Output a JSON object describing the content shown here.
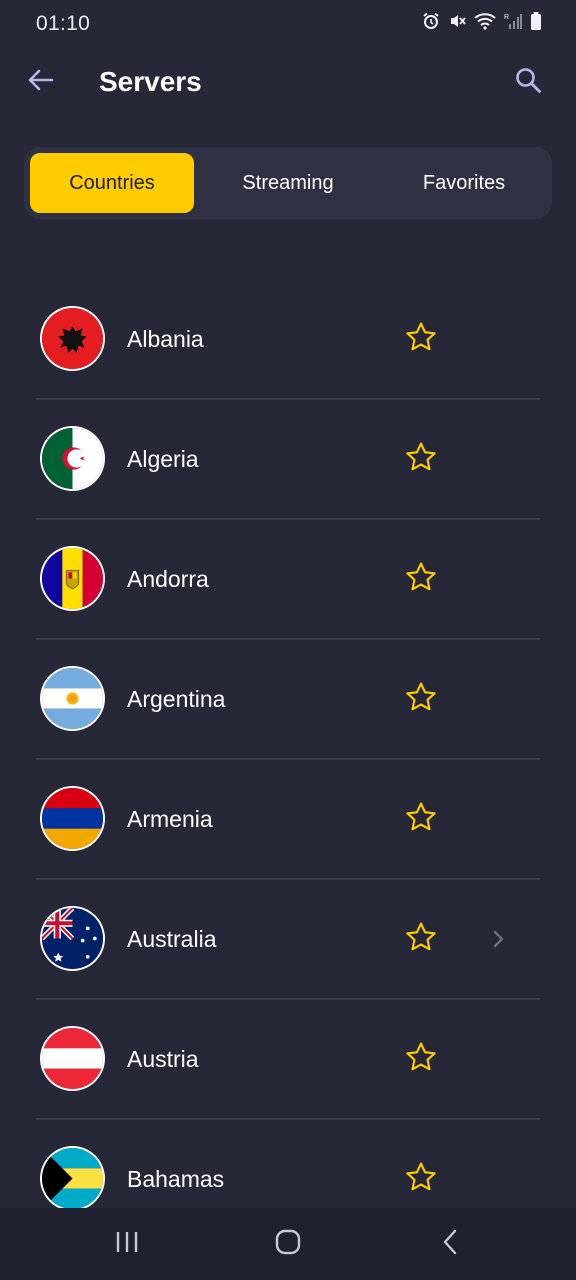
{
  "status_bar": {
    "time": "01:10",
    "icons": [
      "alarm-icon",
      "vibrate-off-icon",
      "wifi-icon",
      "signal-icon",
      "battery-icon"
    ]
  },
  "app_bar": {
    "title": "Servers",
    "back_icon": "arrow-left-icon",
    "search_icon": "search-icon"
  },
  "tabs": [
    {
      "label": "Countries",
      "active": true
    },
    {
      "label": "Streaming",
      "active": false
    },
    {
      "label": "Favorites",
      "active": false
    }
  ],
  "countries": [
    {
      "name": "Albania",
      "flag": "albania-flag",
      "favorite": false,
      "has_children": false
    },
    {
      "name": "Algeria",
      "flag": "algeria-flag",
      "favorite": false,
      "has_children": false
    },
    {
      "name": "Andorra",
      "flag": "andorra-flag",
      "favorite": false,
      "has_children": false
    },
    {
      "name": "Argentina",
      "flag": "argentina-flag",
      "favorite": false,
      "has_children": false
    },
    {
      "name": "Armenia",
      "flag": "armenia-flag",
      "favorite": false,
      "has_children": false
    },
    {
      "name": "Australia",
      "flag": "australia-flag",
      "favorite": false,
      "has_children": true
    },
    {
      "name": "Austria",
      "flag": "austria-flag",
      "favorite": false,
      "has_children": false
    },
    {
      "name": "Bahamas",
      "flag": "bahamas-flag",
      "favorite": false,
      "has_children": false
    }
  ],
  "colors": {
    "background": "#262837",
    "accent": "#ffcc00",
    "tab_bar": "#2f3142",
    "divider": "#3a3c4c",
    "icon": "#b8b6ef"
  },
  "nav_bar": {
    "recents_icon": "recents-icon",
    "home_icon": "home-icon",
    "back_icon": "back-icon"
  }
}
